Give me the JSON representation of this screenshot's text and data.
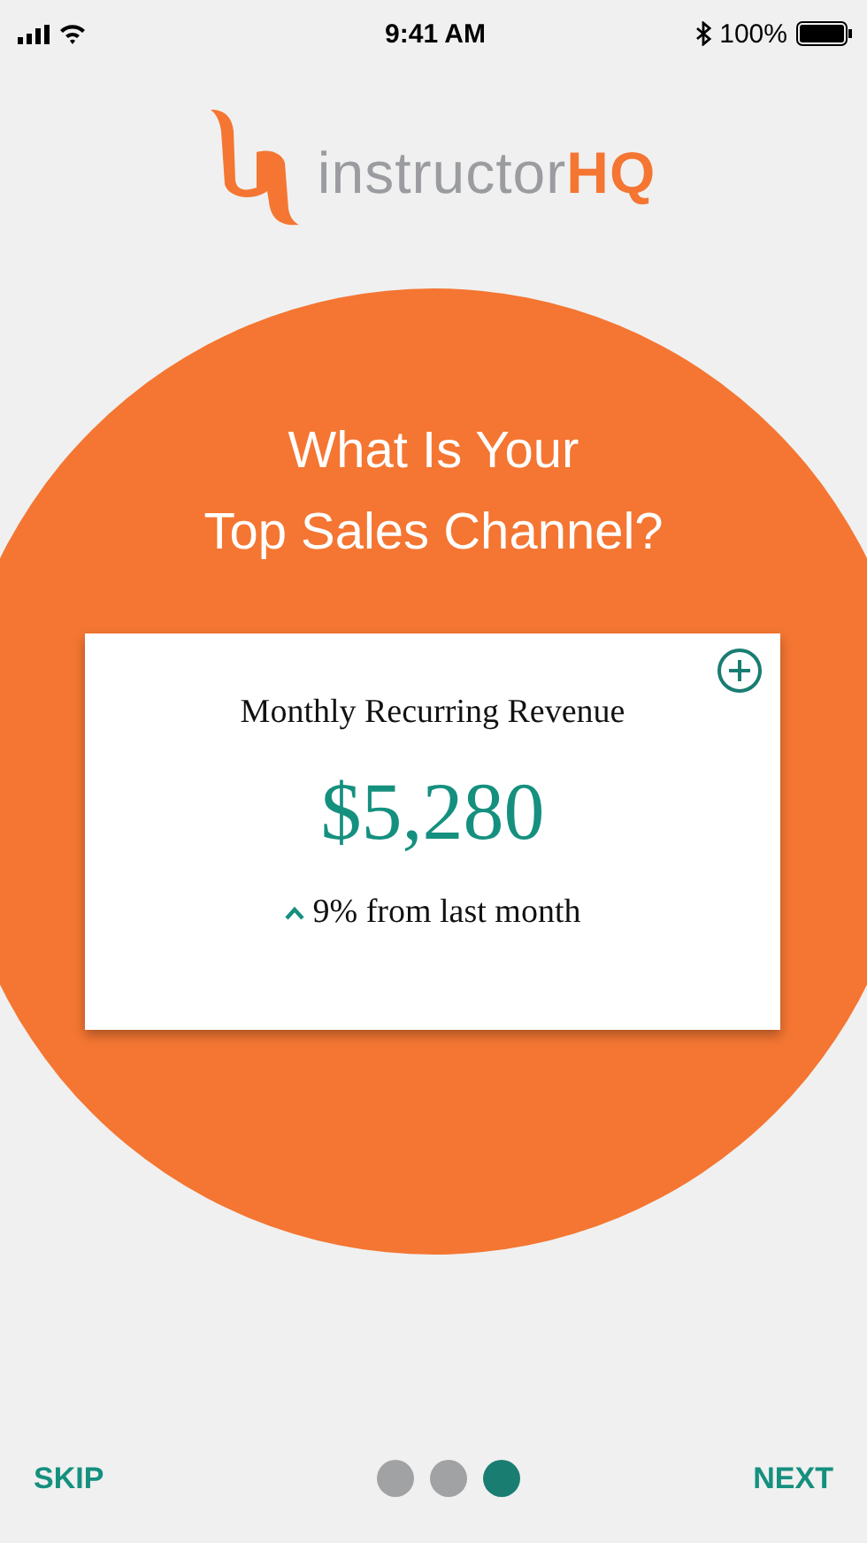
{
  "status_bar": {
    "time": "9:41 AM",
    "battery": "100%"
  },
  "logo": {
    "text": "instructor**HQ**"
  },
  "heading": {
    "lines": [
      "What Is Your",
      "Top Sales Channel?"
    ]
  },
  "card": {
    "title": "Monthly Recurring Revenue",
    "value": "$5,280",
    "change": "9% from last month"
  },
  "footer": {
    "skip": "SKIP",
    "next": "NEXT",
    "pages": [
      {
        "selected": false
      },
      {
        "selected": false
      },
      {
        "selected": true
      }
    ]
  }
}
